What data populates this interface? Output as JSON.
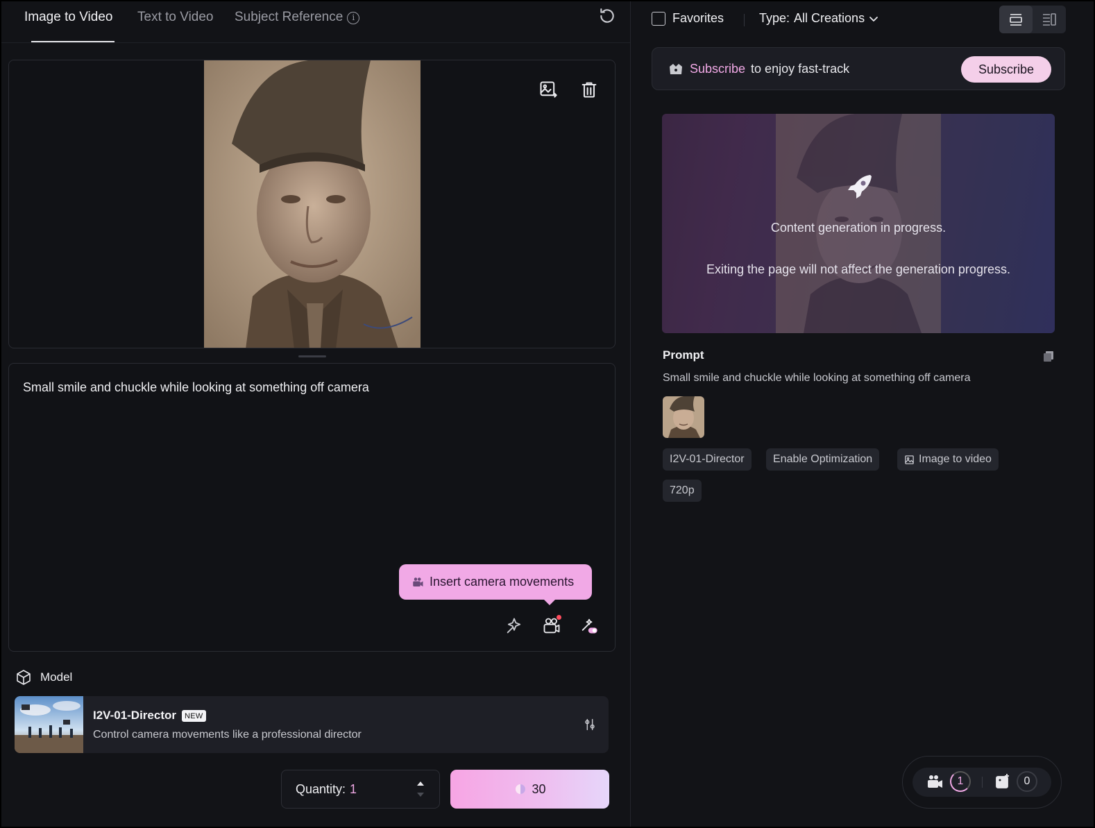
{
  "tabs": [
    {
      "label": "Image to Video",
      "active": true
    },
    {
      "label": "Text to Video",
      "active": false
    },
    {
      "label": "Subject Reference",
      "active": false
    }
  ],
  "prompt": {
    "text": "Small smile and chuckle while looking at something off camera"
  },
  "tooltip": {
    "label": "Insert camera movements"
  },
  "model": {
    "section_label": "Model",
    "name": "I2V-01-Director",
    "badge": "NEW",
    "description": "Control camera movements like a professional director"
  },
  "quantity": {
    "label": "Quantity:",
    "value": "1"
  },
  "generate": {
    "cost": "30"
  },
  "filters": {
    "favorites_label": "Favorites",
    "type_label": "Type:",
    "type_value": "All Creations"
  },
  "subscribe_bar": {
    "accent": "Subscribe",
    "text": "to enjoy fast-track",
    "button": "Subscribe"
  },
  "generation": {
    "line1": "Content generation in progress.",
    "line2": "Exiting the page will not affect the generation progress."
  },
  "detail": {
    "prompt_title": "Prompt",
    "prompt_text": "Small smile and chuckle while looking at something off camera",
    "tags": [
      "I2V-01-Director",
      "Enable Optimization",
      "Image to video",
      "720p"
    ]
  },
  "queue": {
    "video_count": "1",
    "image_count": "0"
  },
  "colors": {
    "accent": "#f1a9e6",
    "background": "#121317",
    "panel": "#111216"
  }
}
